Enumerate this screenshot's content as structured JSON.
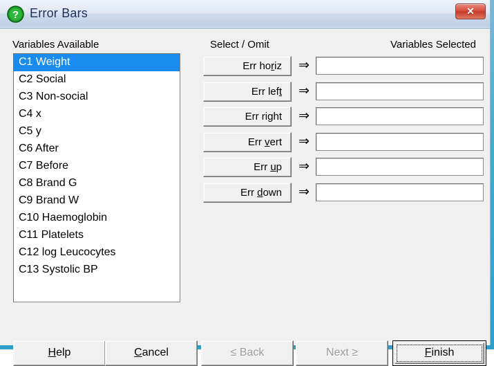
{
  "window": {
    "title": "Error Bars",
    "icon": "question-mark-icon",
    "close_label": "✕",
    "accent_title_color": "#1b2f5e",
    "close_button_color": "#c63a28",
    "selection_color": "#1a8cf0"
  },
  "headers": {
    "available": "Variables Available",
    "select_omit": "Select / Omit",
    "selected": "Variables Selected"
  },
  "variables_available": [
    {
      "label": "C1 Weight",
      "selected": true
    },
    {
      "label": "C2 Social",
      "selected": false
    },
    {
      "label": "C3 Non-social",
      "selected": false
    },
    {
      "label": "C4 x",
      "selected": false
    },
    {
      "label": "C5 y",
      "selected": false
    },
    {
      "label": "C6 After",
      "selected": false
    },
    {
      "label": "C7 Before",
      "selected": false
    },
    {
      "label": "C8 Brand G",
      "selected": false
    },
    {
      "label": "C9 Brand W",
      "selected": false
    },
    {
      "label": "C10 Haemoglobin",
      "selected": false
    },
    {
      "label": "C11 Platelets",
      "selected": false
    },
    {
      "label": "C12 log Leucocytes",
      "selected": false
    },
    {
      "label": "C13 Systolic BP",
      "selected": false
    }
  ],
  "select_rows": [
    {
      "button_pre": "Err ho",
      "button_mnemonic": "r",
      "button_post": "iz",
      "arrow": "⇒",
      "field_value": "",
      "field_placeholder": ""
    },
    {
      "button_pre": "Err lef",
      "button_mnemonic": "t",
      "button_post": "",
      "arrow": "⇒",
      "field_value": "",
      "field_placeholder": ""
    },
    {
      "button_pre": "Err ri",
      "button_mnemonic": "g",
      "button_post": "ht",
      "arrow": "⇒",
      "field_value": "",
      "field_placeholder": ""
    },
    {
      "button_pre": "Err ",
      "button_mnemonic": "v",
      "button_post": "ert",
      "arrow": "⇒",
      "field_value": "",
      "field_placeholder": ""
    },
    {
      "button_pre": "Err ",
      "button_mnemonic": "u",
      "button_post": "p",
      "arrow": "⇒",
      "field_value": "",
      "field_placeholder": ""
    },
    {
      "button_pre": "Err ",
      "button_mnemonic": "d",
      "button_post": "own",
      "arrow": "⇒",
      "field_value": "",
      "field_placeholder": ""
    }
  ],
  "bottom_buttons": {
    "help": {
      "pre": "",
      "mnemonic": "H",
      "post": "elp",
      "enabled": true,
      "default": false
    },
    "cancel": {
      "pre": "",
      "mnemonic": "C",
      "post": "ancel",
      "enabled": true,
      "default": false
    },
    "back": {
      "label": "≤ Back",
      "enabled": false,
      "default": false
    },
    "next": {
      "label": "Next ≥",
      "enabled": false,
      "default": false
    },
    "finish": {
      "pre": "",
      "mnemonic": "F",
      "post": "inish",
      "enabled": true,
      "default": true
    }
  }
}
